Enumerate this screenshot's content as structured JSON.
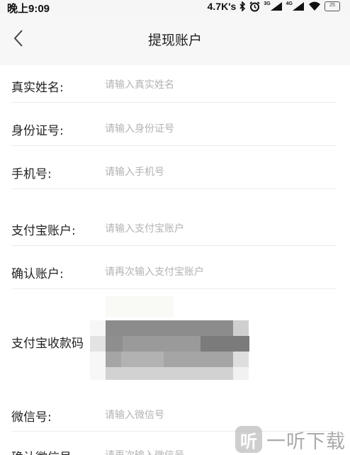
{
  "status_bar": {
    "time": "晚上9:09",
    "net_speed": "4.7K's",
    "signal1_label": "3G",
    "signal2_label": "4G",
    "battery_level": "25"
  },
  "nav": {
    "title": "提现账户"
  },
  "form": {
    "real_name": {
      "label": "真实姓名:",
      "placeholder": "请输入真实姓名"
    },
    "id_number": {
      "label": "身份证号:",
      "placeholder": "请输入身份证号"
    },
    "phone": {
      "label": "手机号:",
      "placeholder": "请输入手机号"
    },
    "alipay_account": {
      "label": "支付宝账户:",
      "placeholder": "请输入支付宝账户"
    },
    "confirm_account": {
      "label": "确认账户:",
      "placeholder": "请再次输入支付宝账户"
    },
    "alipay_qr": {
      "label": "支付宝收款码"
    },
    "wechat": {
      "label": "微信号:",
      "placeholder": "请输入微信号"
    },
    "confirm_wechat": {
      "label": "确认微信号:",
      "placeholder": "请再次输入微信号"
    }
  },
  "watermark": {
    "badge": "听",
    "text": "一听下载"
  }
}
